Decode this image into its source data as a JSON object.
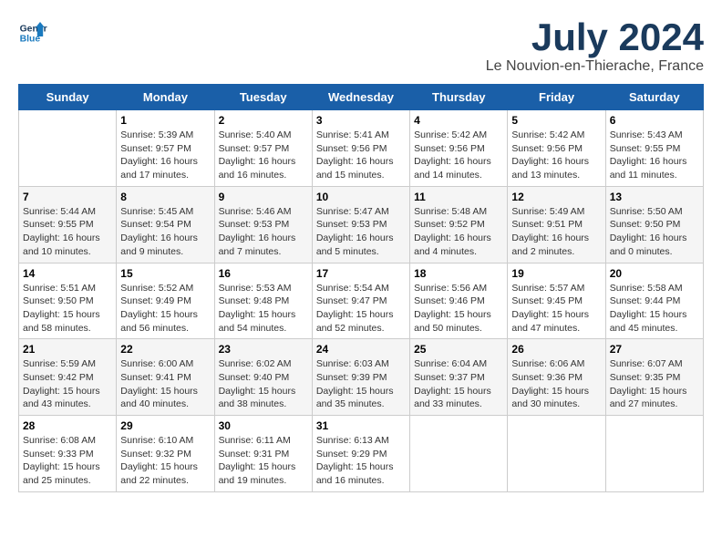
{
  "header": {
    "logo_line1": "General",
    "logo_line2": "Blue",
    "month": "July 2024",
    "location": "Le Nouvion-en-Thierache, France"
  },
  "weekdays": [
    "Sunday",
    "Monday",
    "Tuesday",
    "Wednesday",
    "Thursday",
    "Friday",
    "Saturday"
  ],
  "weeks": [
    [
      {
        "day": "",
        "info": ""
      },
      {
        "day": "1",
        "info": "Sunrise: 5:39 AM\nSunset: 9:57 PM\nDaylight: 16 hours\nand 17 minutes."
      },
      {
        "day": "2",
        "info": "Sunrise: 5:40 AM\nSunset: 9:57 PM\nDaylight: 16 hours\nand 16 minutes."
      },
      {
        "day": "3",
        "info": "Sunrise: 5:41 AM\nSunset: 9:56 PM\nDaylight: 16 hours\nand 15 minutes."
      },
      {
        "day": "4",
        "info": "Sunrise: 5:42 AM\nSunset: 9:56 PM\nDaylight: 16 hours\nand 14 minutes."
      },
      {
        "day": "5",
        "info": "Sunrise: 5:42 AM\nSunset: 9:56 PM\nDaylight: 16 hours\nand 13 minutes."
      },
      {
        "day": "6",
        "info": "Sunrise: 5:43 AM\nSunset: 9:55 PM\nDaylight: 16 hours\nand 11 minutes."
      }
    ],
    [
      {
        "day": "7",
        "info": "Sunrise: 5:44 AM\nSunset: 9:55 PM\nDaylight: 16 hours\nand 10 minutes."
      },
      {
        "day": "8",
        "info": "Sunrise: 5:45 AM\nSunset: 9:54 PM\nDaylight: 16 hours\nand 9 minutes."
      },
      {
        "day": "9",
        "info": "Sunrise: 5:46 AM\nSunset: 9:53 PM\nDaylight: 16 hours\nand 7 minutes."
      },
      {
        "day": "10",
        "info": "Sunrise: 5:47 AM\nSunset: 9:53 PM\nDaylight: 16 hours\nand 5 minutes."
      },
      {
        "day": "11",
        "info": "Sunrise: 5:48 AM\nSunset: 9:52 PM\nDaylight: 16 hours\nand 4 minutes."
      },
      {
        "day": "12",
        "info": "Sunrise: 5:49 AM\nSunset: 9:51 PM\nDaylight: 16 hours\nand 2 minutes."
      },
      {
        "day": "13",
        "info": "Sunrise: 5:50 AM\nSunset: 9:50 PM\nDaylight: 16 hours\nand 0 minutes."
      }
    ],
    [
      {
        "day": "14",
        "info": "Sunrise: 5:51 AM\nSunset: 9:50 PM\nDaylight: 15 hours\nand 58 minutes."
      },
      {
        "day": "15",
        "info": "Sunrise: 5:52 AM\nSunset: 9:49 PM\nDaylight: 15 hours\nand 56 minutes."
      },
      {
        "day": "16",
        "info": "Sunrise: 5:53 AM\nSunset: 9:48 PM\nDaylight: 15 hours\nand 54 minutes."
      },
      {
        "day": "17",
        "info": "Sunrise: 5:54 AM\nSunset: 9:47 PM\nDaylight: 15 hours\nand 52 minutes."
      },
      {
        "day": "18",
        "info": "Sunrise: 5:56 AM\nSunset: 9:46 PM\nDaylight: 15 hours\nand 50 minutes."
      },
      {
        "day": "19",
        "info": "Sunrise: 5:57 AM\nSunset: 9:45 PM\nDaylight: 15 hours\nand 47 minutes."
      },
      {
        "day": "20",
        "info": "Sunrise: 5:58 AM\nSunset: 9:44 PM\nDaylight: 15 hours\nand 45 minutes."
      }
    ],
    [
      {
        "day": "21",
        "info": "Sunrise: 5:59 AM\nSunset: 9:42 PM\nDaylight: 15 hours\nand 43 minutes."
      },
      {
        "day": "22",
        "info": "Sunrise: 6:00 AM\nSunset: 9:41 PM\nDaylight: 15 hours\nand 40 minutes."
      },
      {
        "day": "23",
        "info": "Sunrise: 6:02 AM\nSunset: 9:40 PM\nDaylight: 15 hours\nand 38 minutes."
      },
      {
        "day": "24",
        "info": "Sunrise: 6:03 AM\nSunset: 9:39 PM\nDaylight: 15 hours\nand 35 minutes."
      },
      {
        "day": "25",
        "info": "Sunrise: 6:04 AM\nSunset: 9:37 PM\nDaylight: 15 hours\nand 33 minutes."
      },
      {
        "day": "26",
        "info": "Sunrise: 6:06 AM\nSunset: 9:36 PM\nDaylight: 15 hours\nand 30 minutes."
      },
      {
        "day": "27",
        "info": "Sunrise: 6:07 AM\nSunset: 9:35 PM\nDaylight: 15 hours\nand 27 minutes."
      }
    ],
    [
      {
        "day": "28",
        "info": "Sunrise: 6:08 AM\nSunset: 9:33 PM\nDaylight: 15 hours\nand 25 minutes."
      },
      {
        "day": "29",
        "info": "Sunrise: 6:10 AM\nSunset: 9:32 PM\nDaylight: 15 hours\nand 22 minutes."
      },
      {
        "day": "30",
        "info": "Sunrise: 6:11 AM\nSunset: 9:31 PM\nDaylight: 15 hours\nand 19 minutes."
      },
      {
        "day": "31",
        "info": "Sunrise: 6:13 AM\nSunset: 9:29 PM\nDaylight: 15 hours\nand 16 minutes."
      },
      {
        "day": "",
        "info": ""
      },
      {
        "day": "",
        "info": ""
      },
      {
        "day": "",
        "info": ""
      }
    ]
  ]
}
